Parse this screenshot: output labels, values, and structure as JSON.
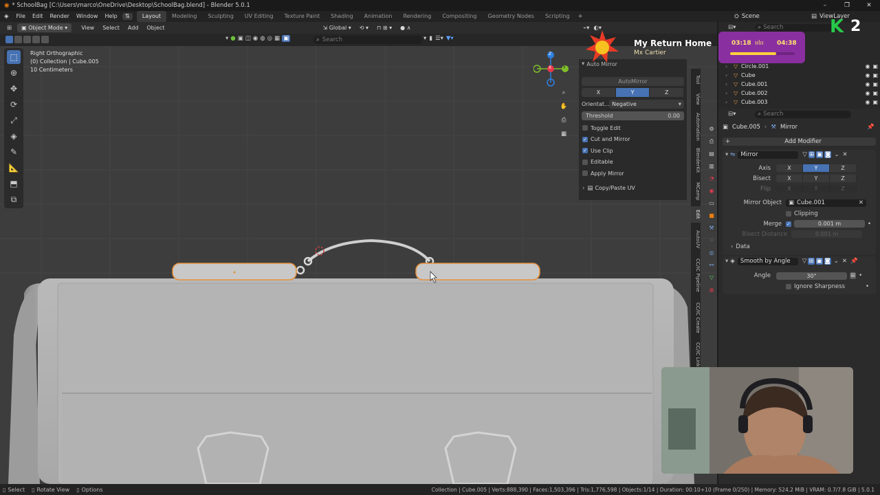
{
  "window": {
    "title": "* SchoolBag [C:\\Users\\marco\\OneDrive\\Desktop\\SchoolBag.blend] - Blender 5.0.1",
    "controls": [
      "–",
      "❐",
      "✕"
    ]
  },
  "menu": {
    "items": [
      "File",
      "Edit",
      "Render",
      "Window",
      "Help"
    ],
    "workspaces": [
      "Layout",
      "Modeling",
      "Sculpting",
      "UV Editing",
      "Texture Paint",
      "Shading",
      "Animation",
      "Rendering",
      "Compositing",
      "Geometry Nodes",
      "Scripting"
    ],
    "active_workspace": "Layout",
    "scene": "Scene",
    "view_layer": "ViewLayer"
  },
  "viewport_header": {
    "mode": "Object Mode",
    "menus": [
      "View",
      "Select",
      "Add",
      "Object"
    ],
    "orientation": "Global",
    "search_placeholder": "Search"
  },
  "viewport_info": {
    "view": "Right Orthographic",
    "collection": "(0) Collection | Cube.005",
    "scale": "10 Centimeters"
  },
  "gizmo": {
    "axes": [
      "Z",
      "Y",
      "X"
    ],
    "colors": {
      "x": "#e6394b",
      "y": "#7fbf2a",
      "z": "#2f7fe0"
    }
  },
  "npanel": {
    "header": "Auto Mirror",
    "button": "AutoMirror",
    "axis": [
      "X",
      "Y",
      "Z"
    ],
    "axis_selected": "Y",
    "orientation_label": "Orientat...",
    "orientation_value": "Negative",
    "threshold_label": "Threshold",
    "threshold_value": "0.00",
    "options": [
      {
        "label": "Toggle Edit",
        "checked": false
      },
      {
        "label": "Cut and Mirror",
        "checked": true
      },
      {
        "label": "Use Clip",
        "checked": true
      },
      {
        "label": "Editable",
        "checked": false
      },
      {
        "label": "Apply Mirror",
        "checked": false
      }
    ],
    "copy_paste": "Copy/Paste UV"
  },
  "side_tabs": [
    "Tool",
    "View",
    "Automation",
    "BlenderKit",
    "MCamp",
    "Edit",
    "AutoUV",
    "CC/IC Pipeline",
    "CC/IC Create",
    "CC/IC Link"
  ],
  "outliner": {
    "search_placeholder": "Search",
    "items": [
      "Circle.001",
      "Cube",
      "Cube.001",
      "Cube.002",
      "Cube.003"
    ]
  },
  "properties": {
    "search_placeholder": "Search",
    "object": "Cube.005",
    "modifier_path": "Mirror",
    "add_modifier": "Add Modifier",
    "mirror": {
      "name": "Mirror",
      "axis_label": "Axis",
      "bisect_label": "Bisect",
      "flip_label": "Flip",
      "axes": [
        "X",
        "Y",
        "Z"
      ],
      "axis_selected": "Y",
      "mirror_object_label": "Mirror Object",
      "mirror_object": "Cube.001",
      "clipping": "Clipping",
      "merge_label": "Merge",
      "merge_value": "0.001 m",
      "bisect_distance_label": "Bisect Distance",
      "bisect_distance_value": "0.001 m",
      "data": "Data"
    },
    "smooth": {
      "name": "Smooth by Angle",
      "angle_label": "Angle",
      "angle_value": "30°",
      "ignore_sharpness": "Ignore Sharpness"
    }
  },
  "overlay": {
    "song_title": "My Return Home",
    "song_artist": "Mx Cartier",
    "timer_elapsed": "03:18",
    "timer_total": "04:38",
    "timer_progress": 0.71,
    "badge": "2"
  },
  "status": {
    "left": [
      "Select",
      "Rotate View",
      "Options"
    ],
    "stats": "Collection | Cube.005 | Verts:888,390 | Faces:1,503,396 | Tris:1,776,598 | Objects:1/14 | Duration: 00:10+10 (Frame 0/250) | Memory: 524.2 MiB | VRAM: 0.7/7.8 GiB | 5.0.1"
  }
}
